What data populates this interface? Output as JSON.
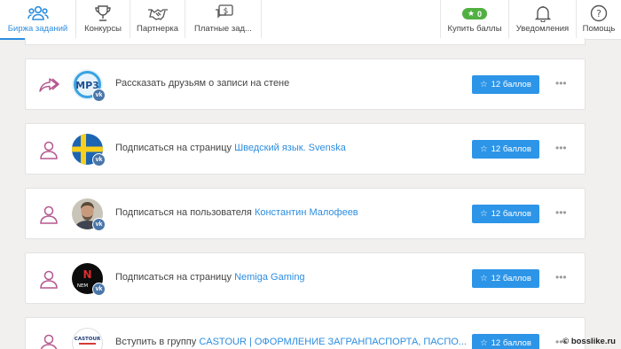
{
  "nav": {
    "left": [
      {
        "label": "Биржа заданий",
        "icon": "users-icon",
        "active": true
      },
      {
        "label": "Конкурсы",
        "icon": "trophy-icon"
      },
      {
        "label": "Партнерка",
        "icon": "handshake-icon"
      },
      {
        "label": "Платные зад...",
        "icon": "paid-chat-icon"
      }
    ],
    "right": [
      {
        "label": "Купить баллы",
        "badge": "0",
        "icon": "star-icon"
      },
      {
        "label": "Уведомления",
        "icon": "bell-icon"
      },
      {
        "label": "Помощь",
        "icon": "help-icon"
      }
    ]
  },
  "tasks": [
    {
      "type_icon": "share-icon",
      "avatar": "mp3-logo",
      "prefix": "Рассказать друзьям о записи на стене",
      "link": "",
      "reward": "12 баллов"
    },
    {
      "type_icon": "user-icon",
      "avatar": "swedish-flag",
      "prefix": "Подписаться на страницу",
      "link": "Шведский язык. Svenska",
      "reward": "12 баллов"
    },
    {
      "type_icon": "user-icon",
      "avatar": "person-photo",
      "prefix": "Подписаться на пользователя",
      "link": "Константин Малофеев",
      "reward": "12 баллов"
    },
    {
      "type_icon": "user-icon",
      "avatar": "nemiga-logo",
      "prefix": "Подписаться на страницу",
      "link": "Nemiga Gaming",
      "reward": "12 баллов"
    },
    {
      "type_icon": "user-icon",
      "avatar": "castour-logo",
      "prefix": "Вступить в группу",
      "link": "CASTOUR | ОФОРМЛЕНИЕ ЗАГРАНПАСПОРТА, ПАСПО...",
      "reward": "12 баллов"
    }
  ],
  "avatar_text": {
    "mp3": "MP3",
    "castour": "CASTOUR",
    "nemiga": "N",
    "nemiga_small": "NEM"
  },
  "vk_label": "vk",
  "more_label": "•••",
  "watermark": "© bosslike.ru",
  "colors": {
    "accent": "#2d95e8",
    "link": "#2c8de0",
    "badge": "#52b043",
    "task_icon": "#b5578e"
  }
}
